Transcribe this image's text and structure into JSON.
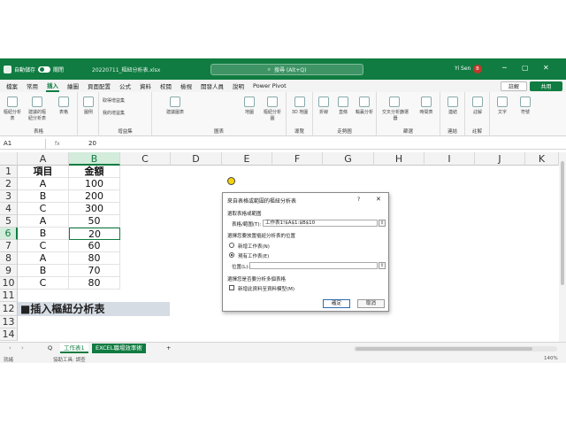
{
  "titlebar": {
    "autosave": "自動儲存",
    "autosave_state": "關閉",
    "filename": "20220711_樞紐分析表.xlsx",
    "search_placeholder": "搜尋 (Alt+Q)",
    "user": "Yi Sen",
    "avatar_initial": "B",
    "min": "─",
    "max": "▢",
    "close": "✕"
  },
  "tabs": [
    "檔案",
    "常用",
    "插入",
    "繪圖",
    "頁面配置",
    "公式",
    "資料",
    "校閱",
    "檢視",
    "開發人員",
    "說明",
    "Power Pivot"
  ],
  "active_tab": "插入",
  "comment_label": "註解",
  "share_label": "共用",
  "ribbon": {
    "groups": [
      {
        "label": "表格",
        "items": [
          "樞紐分析表",
          "建議的樞紐分析表",
          "表格"
        ]
      },
      {
        "label": "",
        "items": [
          "圖例"
        ]
      },
      {
        "label": "增益集",
        "items": [
          "取得增益集",
          "我的增益集"
        ]
      },
      {
        "label": "圖表",
        "items": [
          "建議圖表",
          "地圖",
          "樞紐分析圖"
        ]
      },
      {
        "label": "導覽",
        "items": [
          "3D 地圖"
        ]
      },
      {
        "label": "走勢圖",
        "items": [
          "折線",
          "直條",
          "輸贏分析"
        ]
      },
      {
        "label": "篩選",
        "items": [
          "交叉分析篩選器",
          "時間表"
        ]
      },
      {
        "label": "連結",
        "items": [
          "連結"
        ]
      },
      {
        "label": "註解",
        "items": [
          "註解"
        ]
      },
      {
        "label": "",
        "items": [
          "文字",
          "符號"
        ]
      }
    ]
  },
  "formula_bar": {
    "name_box": "A1",
    "fx": "fx",
    "value": "20"
  },
  "columns": [
    "A",
    "B",
    "C",
    "D",
    "E",
    "F",
    "G",
    "H",
    "I",
    "J",
    "K"
  ],
  "rows": [
    "1",
    "2",
    "3",
    "4",
    "5",
    "6",
    "7",
    "8",
    "9",
    "10",
    "11",
    "12",
    "13",
    "14"
  ],
  "table": {
    "headers": [
      "項目",
      "金額"
    ],
    "data": [
      [
        "A",
        "100"
      ],
      [
        "B",
        "200"
      ],
      [
        "C",
        "300"
      ],
      [
        "A",
        "50"
      ],
      [
        "B",
        "20"
      ],
      [
        "C",
        "60"
      ],
      [
        "A",
        "80"
      ],
      [
        "B",
        "70"
      ],
      [
        "C",
        "80"
      ]
    ]
  },
  "banner_text": "■插入樞紐分析表",
  "dialog": {
    "title": "來自表格或範圍的樞紐分析表",
    "help": "?",
    "close": "✕",
    "select_label": "選取表格或範圍",
    "range_label": "表格/範圍(T):",
    "range_value": "工作表1!$A$1:$B$10",
    "place_label": "選擇您要放置樞紐分析表的位置",
    "opt_new": "新增工作表(N)",
    "opt_existing": "現有工作表(E)",
    "location_label": "位置(L):",
    "multi_label": "選擇您是否要分析多個表格",
    "data_model": "新增此資料至資料模型(M)",
    "ok": "確定",
    "cancel": "取消"
  },
  "sheets": {
    "active": "工作表1",
    "other": "EXCEL職場效率術",
    "add": "+",
    "q": "Q"
  },
  "status": {
    "mode": "就緒",
    "accessibility": "協助工具: 調查",
    "zoom": "140%"
  }
}
